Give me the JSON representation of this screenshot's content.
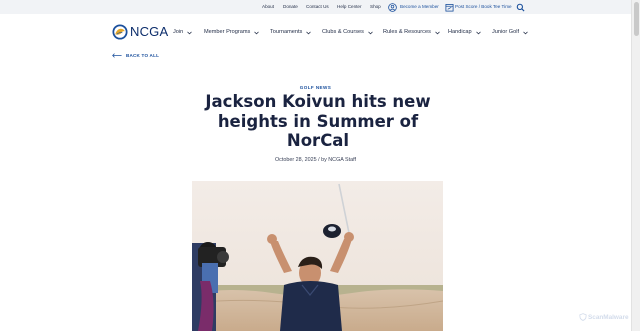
{
  "utility": {
    "about": "About",
    "donate": "Donate",
    "contact": "Contact Us",
    "help": "Help Center",
    "shop": "Shop",
    "member": "Become a Member",
    "post_score": "Post Score / Book Tee Time"
  },
  "logo": {
    "text": "NCGA"
  },
  "nav": [
    {
      "label": "Join"
    },
    {
      "label": "Member Programs"
    },
    {
      "label": "Tournaments"
    },
    {
      "label": "Clubs & Courses"
    },
    {
      "label": "Rules & Resources"
    },
    {
      "label": "Handicap"
    },
    {
      "label": "Junior Golf"
    }
  ],
  "back": {
    "label": "BACK TO ALL"
  },
  "article": {
    "category": "GOLF NEWS",
    "title": "Jackson Koivun hits new heights in Summer of NorCal",
    "byline": "October 28, 2025 / by NCGA Staff"
  },
  "watermark": {
    "text": "ScanMalware"
  },
  "colors": {
    "brand_blue": "#1a4f9c",
    "navy": "#0c2d6b",
    "logo_gold": "#e3a72a"
  },
  "icons": [
    "user-circle-icon",
    "calendar-icon",
    "search-icon",
    "chevron-down-icon",
    "arrow-left-icon",
    "shield-icon"
  ]
}
